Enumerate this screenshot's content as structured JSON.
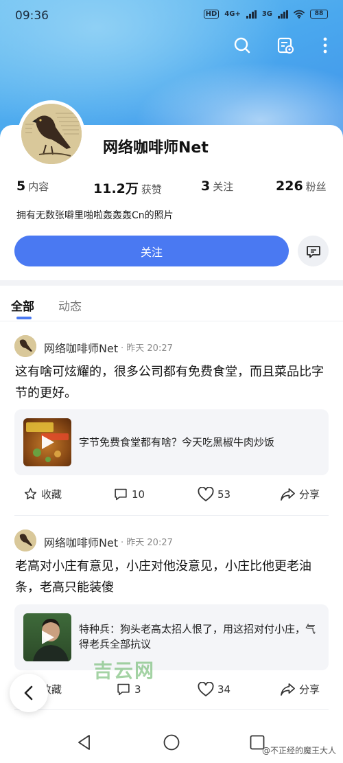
{
  "status_bar": {
    "time": "09:36",
    "hd": "HD",
    "net1": "4G+",
    "net2": "3G",
    "battery": "88"
  },
  "profile": {
    "name": "网络咖啡师Net",
    "stats": [
      {
        "value": "5",
        "label": "内容"
      },
      {
        "value": "11.2万",
        "label": "获赞"
      },
      {
        "value": "3",
        "label": "关注"
      },
      {
        "value": "226",
        "label": "粉丝"
      }
    ],
    "bio": "拥有无数张噼里啪啦轰轰轰Cn的照片",
    "follow_label": "关注"
  },
  "tabs": [
    {
      "label": "全部"
    },
    {
      "label": "动态"
    }
  ],
  "posts": [
    {
      "author": "网络咖啡师Net",
      "time": "· 昨天 20:27",
      "text": "这有啥可炫耀的，很多公司都有免费食堂，而且菜品比字节的更好。",
      "link_title": "字节免费食堂都有啥？今天吃黑椒牛肉炒饭",
      "actions": {
        "collect": "收藏",
        "comments": "10",
        "likes": "53",
        "share": "分享"
      }
    },
    {
      "author": "网络咖啡师Net",
      "time": "· 昨天 20:27",
      "text": "老高对小庄有意见，小庄对他没意见，小庄比他更老油条，老高只能装傻",
      "link_title": "特种兵：狗头老高太招人恨了，用这招对付小庄，气得老兵全部抗议",
      "actions": {
        "collect": "收藏",
        "comments": "3",
        "likes": "34",
        "share": "分享"
      }
    }
  ],
  "watermark": "吉云网",
  "credit": "@不正经的魔王大人",
  "colors": {
    "accent": "#4a79f2",
    "hero_top": "#6fc3f2",
    "hero_bottom": "#3f8ee8"
  }
}
